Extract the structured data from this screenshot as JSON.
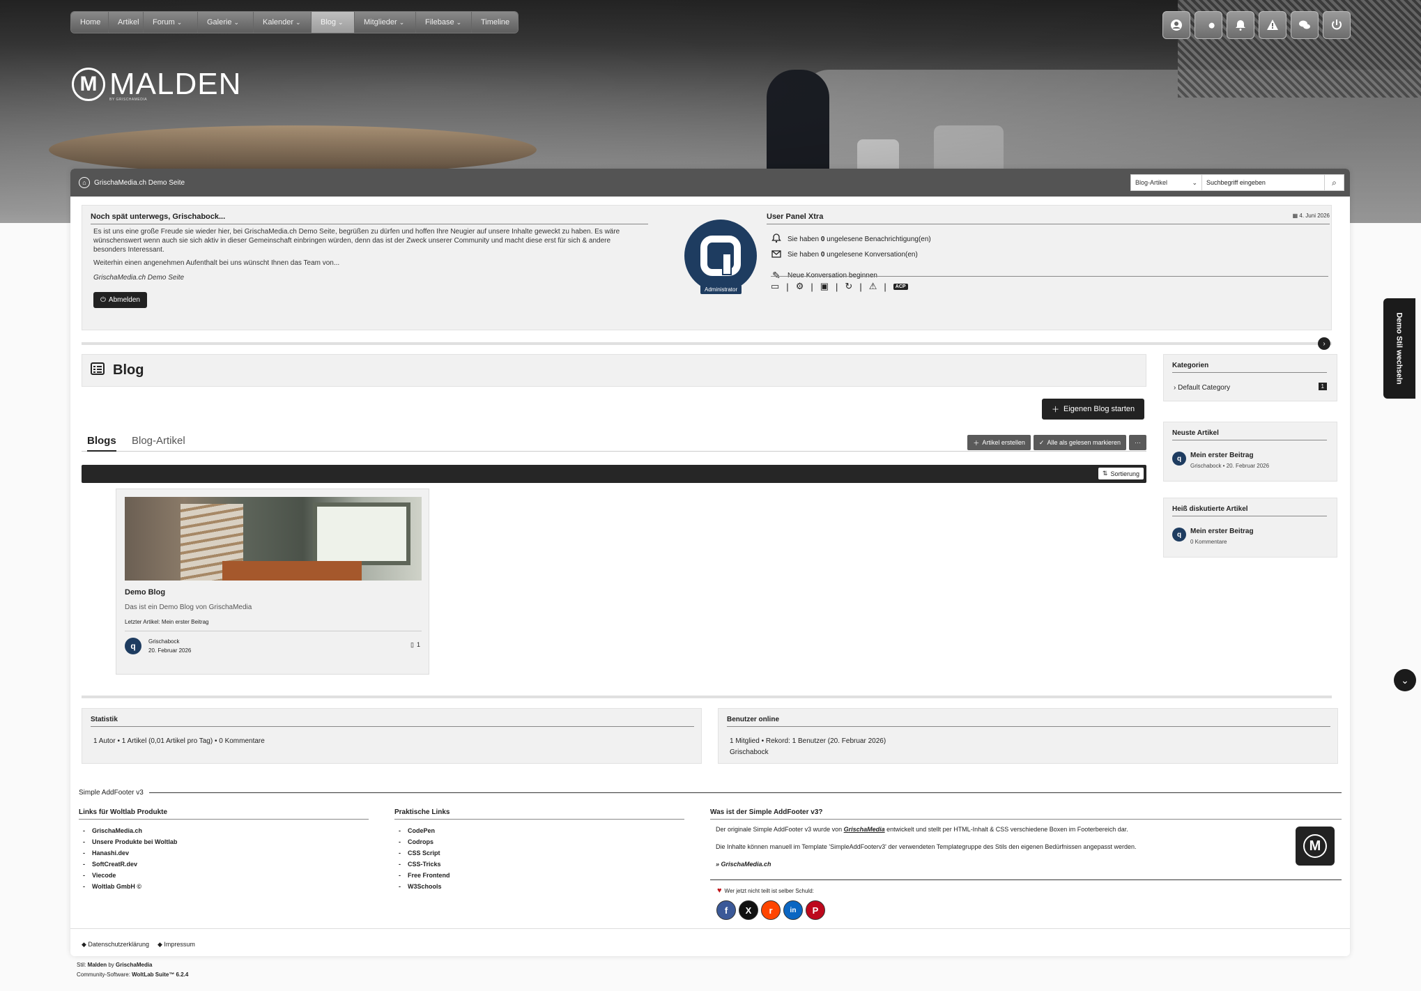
{
  "nav": {
    "items": [
      {
        "label": "Home",
        "dropdown": false
      },
      {
        "label": "Artikel",
        "dropdown": false
      },
      {
        "label": "Forum",
        "dropdown": true
      },
      {
        "label": "Galerie",
        "dropdown": true
      },
      {
        "label": "Kalender",
        "dropdown": true
      },
      {
        "label": "Blog",
        "dropdown": true,
        "active": true
      },
      {
        "label": "Mitglieder",
        "dropdown": true
      },
      {
        "label": "Filebase",
        "dropdown": true
      },
      {
        "label": "Timeline",
        "dropdown": false
      }
    ],
    "user_icons": [
      "user-icon",
      "wrench-icon",
      "bell-icon",
      "warning-icon",
      "chat-icon",
      "power-icon"
    ]
  },
  "logo": {
    "word": "MALDEN",
    "sub": "BY GRISCHAMEDIA",
    "mark": "M"
  },
  "breadcrumb": {
    "label": "GrischaMedia.ch Demo Seite"
  },
  "search": {
    "scope": "Blog-Artikel",
    "placeholder": "Suchbegriff eingeben"
  },
  "welcome": {
    "title": "Noch spät unterwegs, Grischabock...",
    "p1": "Es ist uns eine große Freude sie wieder hier, bei GrischaMedia.ch Demo Seite, begrüßen zu dürfen und hoffen Ihre Neugier auf unsere Inhalte geweckt zu haben. Es wäre wünschenswert wenn auch sie sich aktiv in dieser Gemeinschaft einbringen würden, denn das ist der Zweck unserer Community und macht diese erst für sich & andere besonders Interessant.",
    "p2": "Weiterhin einen angenehmen Aufenthalt bei uns wünscht Ihnen das Team von...",
    "p3": "GrischaMedia.ch Demo Seite",
    "logout": "Abmelden"
  },
  "user_panel": {
    "title": "User Panel Xtra",
    "date": "4. Juni 2026",
    "notif_pre": "Sie haben",
    "notif_count": "0",
    "notif_post": "ungelesene Benachrichtigung(en)",
    "conv_pre": "Sie haben",
    "conv_count": "0",
    "conv_post": "ungelesene Konversation(en)",
    "new_conv": "Neue Konversation beginnen",
    "badge": "Administrator",
    "acp": "ACP"
  },
  "blog": {
    "title": "Blog",
    "new_blog_btn": "Eigenen Blog starten",
    "tabs": [
      "Blogs",
      "Blog-Artikel"
    ],
    "actions": {
      "create": "Artikel erstellen",
      "mark_read": "Alle als gelesen markieren",
      "more": "···"
    },
    "sort_label": "Sortierung",
    "card": {
      "name": "Demo Blog",
      "description": "Das ist ein Demo Blog von GrischaMedia",
      "last_article": "Letzter Artikel: Mein erster Beitrag",
      "author": "Grischabock",
      "date": "20. Februar 2026",
      "count": "1"
    }
  },
  "sidebar": {
    "categories": {
      "title": "Kategorien",
      "item": "Default Category",
      "count": "1"
    },
    "newest": {
      "title": "Neuste Artikel",
      "article": "Mein erster Beitrag",
      "meta": "Grischabock • 20. Februar 2026"
    },
    "hot": {
      "title": "Heiß diskutierte Artikel",
      "article": "Mein erster Beitrag",
      "meta": "0 Kommentare"
    }
  },
  "stats": {
    "title": "Statistik",
    "value": "1 Autor • 1 Artikel (0,01 Artikel pro Tag) • 0 Kommentare"
  },
  "online": {
    "title": "Benutzer online",
    "value": "1 Mitglied • Rekord: 1 Benutzer (20. Februar 2026)",
    "user": "Grischabock"
  },
  "footer": {
    "head": "Simple AddFooter v3",
    "col1": {
      "title": "Links für Woltlab Produkte",
      "items": [
        "GrischaMedia.ch",
        "Unsere Produkte bei Woltlab",
        "Hanashi.dev",
        "SoftCreatR.dev",
        "Viecode",
        "Woltlab GmbH ©"
      ]
    },
    "col2": {
      "title": "Praktische Links",
      "items": [
        "CodePen",
        "Codrops",
        "CSS Script",
        "CSS-Tricks",
        "Free Frontend",
        "W3Schools"
      ]
    },
    "col3": {
      "title": "Was ist der Simple AddFooter v3?",
      "t1_pre": "Der originale Simple AddFooter v3 wurde von ",
      "t1_brand": "GrischaMedia",
      "t1_post": " entwickelt und stellt per HTML-Inhalt & CSS verschiedene Boxen im Footerbereich dar.",
      "t2": "Die Inhalte können manuell im Template 'SimpleAddFooterv3' der verwendeten Templategruppe des Stils den eigenen Bedürfnissen angepasst werden.",
      "t3": "» GrischaMedia.ch",
      "share": "Wer jetzt nicht teilt ist selber Schuld:",
      "social": [
        {
          "name": "facebook-icon",
          "glyph": "f",
          "color": "#3b5998"
        },
        {
          "name": "x-icon",
          "glyph": "X",
          "color": "#111111"
        },
        {
          "name": "reddit-icon",
          "glyph": "r",
          "color": "#ff4500"
        },
        {
          "name": "linkedin-icon",
          "glyph": "in",
          "color": "#0a66c2"
        },
        {
          "name": "pinterest-icon",
          "glyph": "P",
          "color": "#bd081c"
        }
      ]
    },
    "links": [
      "Datenschutzerklärung",
      "Impressum"
    ],
    "credit_style_pre": "Stil: ",
    "credit_style": "Malden",
    "credit_style_by": " by ",
    "credit_style_author": "GrischaMedia",
    "credit_software_pre": "Community-Software: ",
    "credit_software": "WoltLab Suite™ 6.2.4"
  },
  "side_tab": "Demo Stil wechseln"
}
